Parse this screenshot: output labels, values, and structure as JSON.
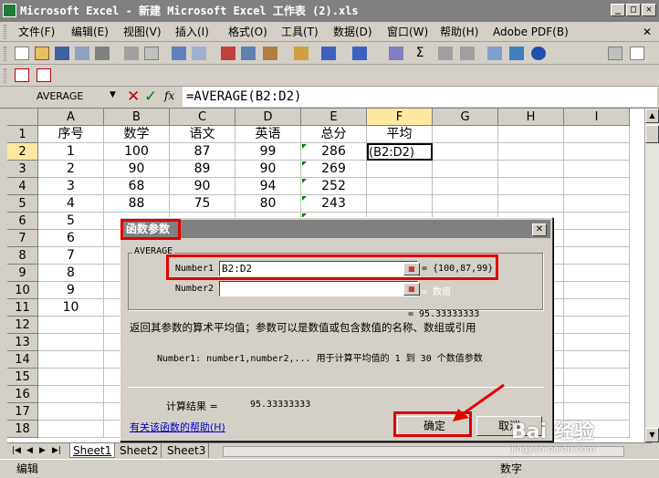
{
  "window": {
    "title": "Microsoft Excel - 新建 Microsoft Excel 工作表 (2).xls",
    "min": "_",
    "max": "□",
    "close": "✕"
  },
  "menu": {
    "items": [
      "文件(F)",
      "编辑(E)",
      "视图(V)",
      "插入(I)",
      "格式(O)",
      "工具(T)",
      "数据(D)",
      "窗口(W)",
      "帮助(H)",
      "Adobe PDF(B)"
    ],
    "doc_close": "✕"
  },
  "formula_bar": {
    "name_box": "AVERAGE",
    "cancel": "✕",
    "enter": "✓",
    "fx": "fx",
    "formula": "=AVERAGE(B2:D2)"
  },
  "sheet": {
    "columns": [
      "A",
      "B",
      "C",
      "D",
      "E",
      "F",
      "G",
      "H",
      "I"
    ],
    "rows": [
      "1",
      "2",
      "3",
      "4",
      "5",
      "6",
      "7",
      "8",
      "9",
      "10",
      "11",
      "12",
      "13",
      "14",
      "15",
      "16",
      "17",
      "18"
    ],
    "cells": [
      [
        "序号",
        "数学",
        "语文",
        "英语",
        "总分",
        "平均"
      ],
      [
        "1",
        "100",
        "87",
        "99",
        "286",
        "(B2:D2)"
      ],
      [
        "2",
        "90",
        "89",
        "90",
        "269",
        ""
      ],
      [
        "3",
        "68",
        "90",
        "94",
        "252",
        ""
      ],
      [
        "4",
        "88",
        "75",
        "80",
        "243",
        ""
      ],
      [
        "5",
        "",
        "",
        "",
        "",
        ""
      ],
      [
        "6",
        "",
        "",
        "",
        "",
        ""
      ],
      [
        "7",
        "",
        "",
        "",
        "",
        ""
      ],
      [
        "8",
        "",
        "",
        "",
        "",
        ""
      ],
      [
        "9",
        "",
        "",
        "",
        "",
        ""
      ],
      [
        "10",
        "",
        "",
        "",
        "",
        ""
      ]
    ],
    "tabs": [
      "Sheet1",
      "Sheet2",
      "Sheet3"
    ],
    "tab_nav": [
      "|◀",
      "◀",
      "▶",
      "▶|"
    ]
  },
  "status": {
    "mode": "编辑",
    "indicator": "数字"
  },
  "dialog": {
    "title": "函数参数",
    "close": "✕",
    "function_name": "AVERAGE",
    "args": [
      {
        "label": "Number1",
        "value": "B2:D2",
        "result": "= {100,87,99}"
      },
      {
        "label": "Number2",
        "value": "",
        "result": "= 数值"
      }
    ],
    "formula_result_line": "= 95.33333333",
    "description": "返回其参数的算术平均值；参数可以是数值或包含数值的名称、数组或引用",
    "arg_help": "Number1:   number1,number2,... 用于计算平均值的 1 到 30 个数值参数",
    "calc_result_label": "计算结果 =",
    "calc_result_value": "95.33333333",
    "help_link": "有关该函数的帮助(H)",
    "ok": "确定",
    "cancel": "取消"
  },
  "watermark": {
    "text": "Bai 经验",
    "sub": "jingyan.baidu.com"
  }
}
